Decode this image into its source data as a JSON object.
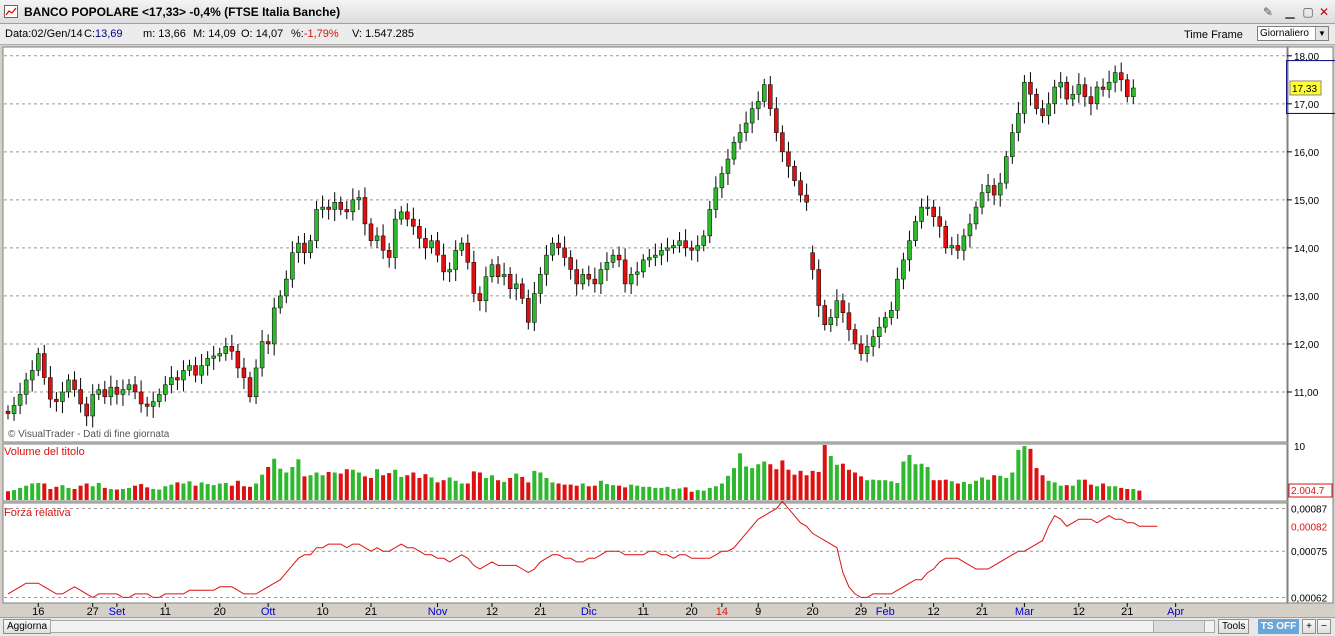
{
  "window": {
    "title": "BANCO POPOLARE <17,33> -0,4%  (FTSE Italia Banche)",
    "colors": {
      "titlebar": "#e6e6e6"
    }
  },
  "infobar": {
    "data_label": "Data:",
    "date": "02/Gen/14",
    "c_label": "C:",
    "c": "13,69",
    "m_label": "m:",
    "m": "13,66",
    "M_label": "M:",
    "M": "14,09",
    "o_label": "O:",
    "o": "14,07",
    "pct_label": "%:",
    "pct": "-1,79%",
    "v_label": "V:",
    "v": "1.547.285",
    "time_frame_label": "Time Frame",
    "time_frame_value": "Giornaliero"
  },
  "bottombar": {
    "update_label": "Aggiorna",
    "tools_label": "Tools",
    "ts_label": "TS OFF",
    "plus": "+",
    "minus": "−"
  },
  "icons": [
    "chart-icon",
    "pin-icon",
    "minimize-icon",
    "maximize-icon",
    "close-icon",
    "chevron-down-icon"
  ],
  "chart_data": {
    "type": "candlestick",
    "price_panel": {
      "watermark": "© VisualTrader - Dati di fine giornata",
      "ylim": [
        10.0,
        18.1
      ],
      "y_ticks": [
        11,
        12,
        13,
        14,
        15,
        16,
        17,
        18
      ],
      "y_tick_labels": [
        "11,00",
        "12,00",
        "13,00",
        "14,00",
        "15,00",
        "16,00",
        "17,00",
        "18,00"
      ],
      "last_price_label": "17,33",
      "last_price": 17.33,
      "grid": "dashed-horizontal",
      "colors": {
        "up": "#2eb82e",
        "down": "#dd1111",
        "wick": "#000000",
        "selection": "#000080"
      },
      "selection_box": {
        "start_index": 212,
        "end_index": 227,
        "low": 16.8,
        "high": 17.9
      },
      "candles_close": [
        10.55,
        10.72,
        10.95,
        11.25,
        11.45,
        11.8,
        11.3,
        10.85,
        10.8,
        11.0,
        11.25,
        11.05,
        10.75,
        10.5,
        10.95,
        11.05,
        10.9,
        11.1,
        10.95,
        11.05,
        11.15,
        11.0,
        10.75,
        10.7,
        10.8,
        10.95,
        11.15,
        11.3,
        11.25,
        11.45,
        11.55,
        11.35,
        11.55,
        11.7,
        11.75,
        11.8,
        11.95,
        11.85,
        11.5,
        11.3,
        10.9,
        11.5,
        12.05,
        12.0,
        12.75,
        13.0,
        13.35,
        13.9,
        14.1,
        13.9,
        14.15,
        14.8,
        14.85,
        14.8,
        14.95,
        14.8,
        14.75,
        15.0,
        15.05,
        14.5,
        14.15,
        14.25,
        13.95,
        13.8,
        14.6,
        14.75,
        14.6,
        14.45,
        14.2,
        14.0,
        14.15,
        13.85,
        13.5,
        13.55,
        13.95,
        14.1,
        13.7,
        13.05,
        12.9,
        13.4,
        13.65,
        13.4,
        13.45,
        13.15,
        13.25,
        12.95,
        12.45,
        13.05,
        13.45,
        13.85,
        14.1,
        14.0,
        13.8,
        13.55,
        13.25,
        13.45,
        13.35,
        13.25,
        13.55,
        13.7,
        13.85,
        13.75,
        13.25,
        13.45,
        13.5,
        13.75,
        13.8,
        13.85,
        13.95,
        14.0,
        14.05,
        14.15,
        14.0,
        13.95,
        14.05,
        14.25,
        14.8,
        15.25,
        15.55,
        15.85,
        16.2,
        16.4,
        16.6,
        16.9,
        17.05,
        17.4,
        16.9,
        16.4,
        16.0,
        15.7,
        15.4,
        15.1,
        14.95,
        13.55,
        12.8,
        12.4,
        12.55,
        12.9,
        12.65,
        12.3,
        12.0,
        11.8,
        11.95,
        12.15,
        12.35,
        12.55,
        12.7,
        13.35,
        13.75,
        14.15,
        14.55,
        14.85,
        14.85,
        14.65,
        14.45,
        14.0,
        14.05,
        13.95,
        14.25,
        14.5,
        14.85,
        15.15,
        15.3,
        15.1,
        15.35,
        15.9,
        16.4,
        16.8,
        17.45,
        17.2,
        16.9,
        16.75,
        17.0,
        17.35,
        17.45,
        17.1,
        17.2,
        17.4,
        17.15,
        17.0,
        17.35,
        17.3,
        17.45,
        17.65,
        17.5,
        17.15,
        17.33
      ],
      "candles_open": [
        10.6,
        10.55,
        10.72,
        10.95,
        11.25,
        11.45,
        11.8,
        11.3,
        10.85,
        10.8,
        11.0,
        11.25,
        11.05,
        10.75,
        10.5,
        10.95,
        11.05,
        10.9,
        11.1,
        10.95,
        11.05,
        11.15,
        11.0,
        10.75,
        10.7,
        10.8,
        10.95,
        11.15,
        11.3,
        11.25,
        11.45,
        11.55,
        11.35,
        11.55,
        11.7,
        11.75,
        11.8,
        11.95,
        11.85,
        11.5,
        11.3,
        10.9,
        11.5,
        12.05,
        12.0,
        12.75,
        13.0,
        13.35,
        13.9,
        14.1,
        13.9,
        14.15,
        14.8,
        14.85,
        14.8,
        14.95,
        14.8,
        14.75,
        15.0,
        15.05,
        14.5,
        14.15,
        14.25,
        13.95,
        13.8,
        14.6,
        14.75,
        14.6,
        14.45,
        14.2,
        14.0,
        14.15,
        13.85,
        13.5,
        13.55,
        13.95,
        14.1,
        13.7,
        13.05,
        12.9,
        13.4,
        13.65,
        13.4,
        13.45,
        13.15,
        13.25,
        12.95,
        12.45,
        13.05,
        13.45,
        13.85,
        14.1,
        14.0,
        13.8,
        13.55,
        13.25,
        13.45,
        13.35,
        13.25,
        13.55,
        13.7,
        13.85,
        13.75,
        13.25,
        13.45,
        13.5,
        13.75,
        13.8,
        13.85,
        13.95,
        14.0,
        14.05,
        14.15,
        14.0,
        13.95,
        14.05,
        14.25,
        14.8,
        15.25,
        15.55,
        15.85,
        16.2,
        16.4,
        16.6,
        16.9,
        17.05,
        17.4,
        16.9,
        16.4,
        16.0,
        15.7,
        15.4,
        15.1,
        13.9,
        13.55,
        12.8,
        12.4,
        12.55,
        12.9,
        12.65,
        12.3,
        12.0,
        11.8,
        11.95,
        12.15,
        12.35,
        12.55,
        12.7,
        13.35,
        13.75,
        14.15,
        14.55,
        14.85,
        14.85,
        14.65,
        14.45,
        14.0,
        14.05,
        13.95,
        14.25,
        14.5,
        14.85,
        15.15,
        15.3,
        15.1,
        15.35,
        15.9,
        16.4,
        16.8,
        17.45,
        17.2,
        16.9,
        16.75,
        17.0,
        17.35,
        17.45,
        17.1,
        17.2,
        17.4,
        17.15,
        17.0,
        17.35,
        17.3,
        17.45,
        17.65,
        17.5,
        17.15
      ]
    },
    "volume_panel": {
      "label": "Volume del titolo",
      "value_label": "2.004.7",
      "scale_label": "10",
      "ylim": [
        0,
        10
      ],
      "values": [
        1.6,
        1.8,
        2.2,
        2.6,
        3.0,
        3.1,
        3.0,
        2.0,
        2.4,
        2.7,
        2.2,
        2.0,
        2.6,
        3.0,
        2.5,
        3.1,
        2.2,
        2.0,
        1.9,
        2.0,
        2.2,
        2.6,
        2.9,
        2.3,
        2.0,
        1.9,
        2.5,
        2.8,
        3.2,
        3.0,
        3.4,
        2.6,
        3.2,
        2.9,
        2.7,
        3.0,
        3.1,
        2.6,
        3.5,
        2.5,
        2.4,
        3.0,
        4.6,
        6.0,
        7.5,
        5.7,
        5.0,
        6.0,
        7.4,
        4.3,
        4.5,
        5.0,
        4.5,
        5.1,
        5.0,
        4.8,
        5.6,
        5.5,
        5.0,
        4.3,
        4.0,
        5.6,
        4.5,
        4.9,
        5.5,
        4.2,
        4.5,
        5.0,
        4.0,
        4.7,
        4.1,
        3.2,
        3.6,
        4.1,
        3.5,
        3.0,
        3.0,
        5.2,
        5.0,
        4.0,
        4.5,
        3.6,
        3.3,
        4.0,
        4.8,
        4.2,
        3.2,
        5.3,
        5.0,
        4.0,
        3.2,
        3.0,
        2.8,
        2.8,
        2.6,
        3.0,
        2.5,
        2.6,
        3.5,
        2.9,
        2.7,
        2.6,
        2.3,
        2.8,
        2.6,
        2.4,
        2.4,
        2.2,
        2.2,
        2.4,
        2.0,
        2.1,
        2.3,
        1.5,
        1.8,
        1.7,
        2.2,
        2.5,
        3.0,
        4.4,
        5.8,
        8.5,
        6.1,
        5.8,
        6.5,
        7.0,
        6.5,
        5.6,
        7.2,
        5.5,
        4.6,
        5.3,
        4.5,
        5.3,
        5.1,
        10.0,
        8.0,
        6.4,
        6.6,
        5.5,
        5.0,
        4.3,
        3.6,
        3.7,
        3.6,
        3.6,
        3.4,
        3.1,
        7.0,
        8.2,
        6.5,
        6.6,
        6.0,
        3.6,
        3.6,
        3.7,
        3.4,
        3.0,
        3.3,
        2.9,
        3.5,
        4.1,
        3.7,
        4.5,
        4.4,
        4.0,
        5.0,
        9.1,
        9.8,
        9.3,
        5.8,
        4.5,
        3.5,
        3.2,
        2.6,
        2.7,
        2.6,
        3.7,
        3.7,
        2.8,
        2.5,
        3.0,
        2.5,
        2.5,
        2.2,
        2.0,
        2.0,
        1.7
      ]
    },
    "rs_panel": {
      "label": "Forza relativa",
      "ylim": [
        0.00061,
        0.00088
      ],
      "y_ticks": [
        0.00062,
        0.00075,
        0.00087
      ],
      "y_tick_labels": [
        "0,00062",
        "0,00075",
        "0,00087"
      ],
      "last_label": "0,00082",
      "last": 0.00082,
      "color": "#dd1111",
      "values": [
        0.00063,
        0.00064,
        0.00065,
        0.00066,
        0.00066,
        0.00066,
        0.00065,
        0.00064,
        0.00063,
        0.00063,
        0.00064,
        0.00065,
        0.00064,
        0.00063,
        0.00062,
        0.00063,
        0.00063,
        0.00063,
        0.00063,
        0.00062,
        0.00062,
        0.00063,
        0.00063,
        0.00063,
        0.00062,
        0.00062,
        0.00063,
        0.00063,
        0.00063,
        0.00063,
        0.00064,
        0.00064,
        0.00064,
        0.00064,
        0.00064,
        0.00065,
        0.00065,
        0.00065,
        0.00064,
        0.00063,
        0.00063,
        0.00063,
        0.00064,
        0.00065,
        0.00066,
        0.00067,
        0.00069,
        0.00071,
        0.00073,
        0.00074,
        0.00074,
        0.00076,
        0.00076,
        0.00077,
        0.00077,
        0.00077,
        0.00076,
        0.00077,
        0.00077,
        0.00076,
        0.00075,
        0.00076,
        0.00075,
        0.00075,
        0.00076,
        0.00077,
        0.00076,
        0.00076,
        0.00075,
        0.00074,
        0.00074,
        0.00073,
        0.00073,
        0.00072,
        0.00073,
        0.00074,
        0.00073,
        0.00071,
        0.0007,
        0.00071,
        0.00072,
        0.00071,
        0.00071,
        0.00071,
        0.00071,
        0.0007,
        0.00069,
        0.0007,
        0.00072,
        0.00073,
        0.00074,
        0.00074,
        0.00073,
        0.00073,
        0.00072,
        0.00072,
        0.00073,
        0.00073,
        0.00074,
        0.00075,
        0.00075,
        0.00075,
        0.00074,
        0.00074,
        0.00074,
        0.00074,
        0.00075,
        0.00075,
        0.00074,
        0.00074,
        0.00073,
        0.00074,
        0.00074,
        0.00073,
        0.00073,
        0.00073,
        0.00073,
        0.00074,
        0.00075,
        0.00075,
        0.00076,
        0.00078,
        0.0008,
        0.00082,
        0.00084,
        0.00085,
        0.00086,
        0.00087,
        0.00089,
        0.00087,
        0.00085,
        0.00083,
        0.00082,
        0.0008,
        0.00079,
        0.00078,
        0.00077,
        0.00076,
        0.00069,
        0.00065,
        0.00063,
        0.00062,
        0.00062,
        0.00063,
        0.00063,
        0.00063,
        0.00063,
        0.00064,
        0.00065,
        0.00066,
        0.00067,
        0.00067,
        0.00069,
        0.0007,
        0.00072,
        0.00073,
        0.00073,
        0.00073,
        0.00072,
        0.00071,
        0.0007,
        0.0007,
        0.0007,
        0.00071,
        0.00072,
        0.00073,
        0.00074,
        0.00075,
        0.00075,
        0.00076,
        0.00077,
        0.00078,
        0.00082,
        0.00085,
        0.00084,
        0.00082,
        0.00083,
        0.00084,
        0.00084,
        0.00084,
        0.00083,
        0.00084,
        0.00085,
        0.00084,
        0.00084,
        0.00083,
        0.00083,
        0.00082,
        0.00082,
        0.00082,
        0.00082
      ]
    },
    "x_axis": {
      "ticks": [
        {
          "i": 5,
          "label": "16",
          "color": "#000000"
        },
        {
          "i": 14,
          "label": "27",
          "color": "#000000"
        },
        {
          "i": 18,
          "label": "Set",
          "color": "#0000cc"
        },
        {
          "i": 26,
          "label": "11",
          "color": "#000000"
        },
        {
          "i": 35,
          "label": "20",
          "color": "#000000"
        },
        {
          "i": 43,
          "label": "Ott",
          "color": "#0000cc"
        },
        {
          "i": 52,
          "label": "10",
          "color": "#000000"
        },
        {
          "i": 60,
          "label": "21",
          "color": "#000000"
        },
        {
          "i": 71,
          "label": "Nov",
          "color": "#0000cc"
        },
        {
          "i": 80,
          "label": "12",
          "color": "#000000"
        },
        {
          "i": 88,
          "label": "21",
          "color": "#000000"
        },
        {
          "i": 96,
          "label": "Dic",
          "color": "#0000cc"
        },
        {
          "i": 105,
          "label": "11",
          "color": "#000000"
        },
        {
          "i": 113,
          "label": "20",
          "color": "#000000"
        },
        {
          "i": 118,
          "label": "14",
          "color": "#dd1111"
        },
        {
          "i": 124,
          "label": "9",
          "color": "#000000"
        },
        {
          "i": 133,
          "label": "20",
          "color": "#000000"
        },
        {
          "i": 141,
          "label": "29",
          "color": "#000000"
        },
        {
          "i": 145,
          "label": "Feb",
          "color": "#0000cc"
        },
        {
          "i": 153,
          "label": "12",
          "color": "#000000"
        },
        {
          "i": 161,
          "label": "21",
          "color": "#000000"
        },
        {
          "i": 168,
          "label": "Mar",
          "color": "#0000cc"
        },
        {
          "i": 177,
          "label": "12",
          "color": "#000000"
        },
        {
          "i": 185,
          "label": "21",
          "color": "#000000"
        },
        {
          "i": 193,
          "label": "Apr",
          "color": "#0000cc"
        }
      ]
    }
  }
}
